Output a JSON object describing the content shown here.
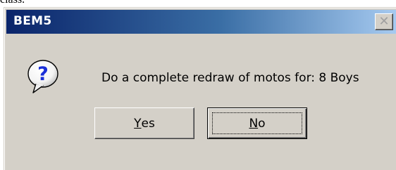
{
  "window": {
    "title": "BEM5",
    "close_glyph": "✕"
  },
  "dialog": {
    "message": "Do a complete redraw of motos for: 8 Boys",
    "icon": "question-icon"
  },
  "buttons": {
    "yes": {
      "mnemonic": "Y",
      "rest": "es"
    },
    "no": {
      "mnemonic": "N",
      "rest": "o"
    }
  },
  "background_text": "class."
}
